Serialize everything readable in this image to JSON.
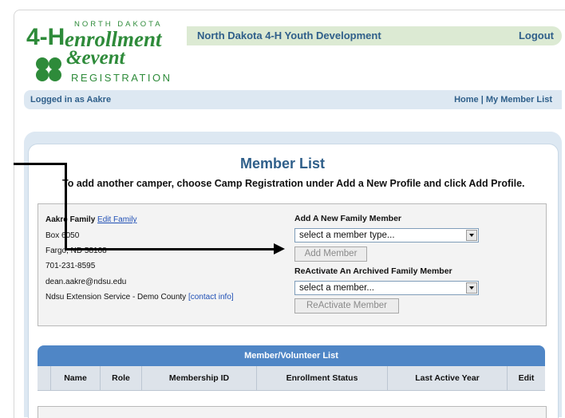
{
  "header": {
    "logo": {
      "line1": "NORTH DAKOTA",
      "line2": "enrollment",
      "line3": "&event",
      "line4": "REGISTRATION",
      "badge": "4-H"
    },
    "org_name": "North Dakota 4-H Youth Development",
    "logout_label": "Logout"
  },
  "login_bar": {
    "logged_in_text": "Logged in as Aakre",
    "home_label": "Home",
    "separator": "|",
    "member_list_label": "My Member List"
  },
  "main": {
    "title": "Member List",
    "instructions": "To add another camper, choose Camp Registration under Add a New Profile and click Add Profile."
  },
  "family": {
    "name": "Aakre Family",
    "edit_label": "Edit Family",
    "address1": "Box 6050",
    "address2": "Fargo, ND 58108",
    "phone": "701-231-8595",
    "email": "dean.aakre@ndsu.edu",
    "county": "Ndsu Extension Service - Demo County",
    "contact_label": "[contact info]"
  },
  "add_member": {
    "title": "Add A New Family Member",
    "select_value": "select a member type...",
    "button_label": "Add Member"
  },
  "reactivate": {
    "title": "ReActivate An Archived Family Member",
    "select_value": "select a member...",
    "button_label": "ReActivate Member"
  },
  "member_table": {
    "title": "Member/Volunteer List",
    "columns": [
      "Name",
      "Role",
      "Membership ID",
      "Enrollment Status",
      "Last Active Year",
      "Edit"
    ]
  },
  "colors": {
    "brand_green": "#2e8b3a",
    "link_blue": "#2f5f8a",
    "table_header": "#4f86c6"
  }
}
